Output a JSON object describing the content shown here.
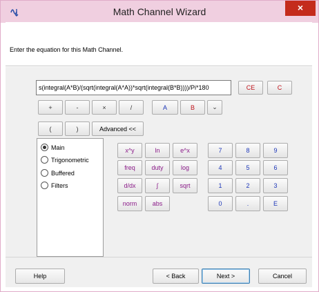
{
  "window": {
    "title": "Math Channel Wizard",
    "close_glyph": "×"
  },
  "header": {
    "instruction": "Enter the equation for this Math Channel."
  },
  "equation": {
    "value": "s(integral(A*B)/(sqrt(integral(A*A))*sqrt(integral(B*B))))/Pi*180"
  },
  "buttons": {
    "ce": "CE",
    "c": "C",
    "plus": "+",
    "minus": "-",
    "times": "×",
    "divide": "/",
    "a": "A",
    "b": "B",
    "dropdown": "⌄",
    "lparen": "(",
    "rparen": ")",
    "advanced": "Advanced <<",
    "pow": "x^y",
    "ln": "ln",
    "exp": "e^x",
    "freq": "freq",
    "duty": "duty",
    "log": "log",
    "deriv": "d/dx",
    "integral": "∫",
    "sqrt": "sqrt",
    "norm": "norm",
    "abs": "abs",
    "n7": "7",
    "n8": "8",
    "n9": "9",
    "n4": "4",
    "n5": "5",
    "n6": "6",
    "n1": "1",
    "n2": "2",
    "n3": "3",
    "n0": "0",
    "dot": ".",
    "e": "E"
  },
  "radio": {
    "selected": "Main",
    "options": [
      "Main",
      "Trigonometric",
      "Buffered",
      "Filters"
    ]
  },
  "footer": {
    "help": "Help",
    "back": "< Back",
    "next": "Next >",
    "cancel": "Cancel"
  },
  "colors": {
    "titlebar": "#f0cfe0",
    "close": "#c42b1c",
    "red_text": "#c0141c",
    "blue_text": "#1c36b8",
    "purple_text": "#8a1a88"
  }
}
